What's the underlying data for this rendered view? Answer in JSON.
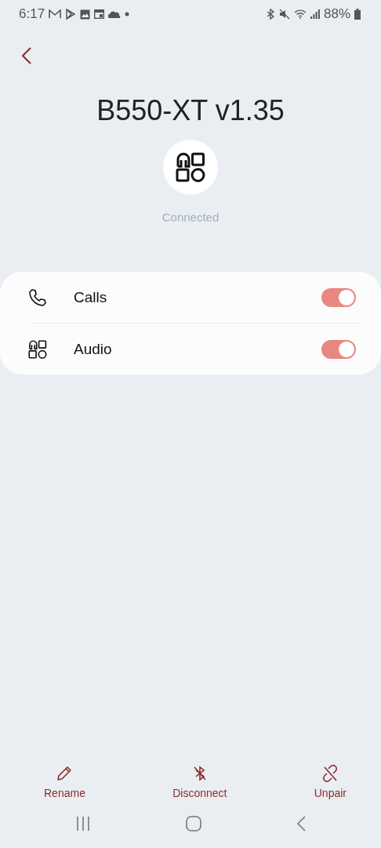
{
  "status_bar": {
    "time": "6:17",
    "battery": "88%"
  },
  "device": {
    "name": "B550-XT v1.35",
    "status": "Connected"
  },
  "settings": [
    {
      "kind": "phone",
      "label": "Calls",
      "on": true
    },
    {
      "kind": "audio",
      "label": "Audio",
      "on": true
    }
  ],
  "actions": [
    {
      "kind": "rename",
      "label": "Rename"
    },
    {
      "kind": "disconnect",
      "label": "Disconnect"
    },
    {
      "kind": "unpair",
      "label": "Unpair"
    }
  ]
}
